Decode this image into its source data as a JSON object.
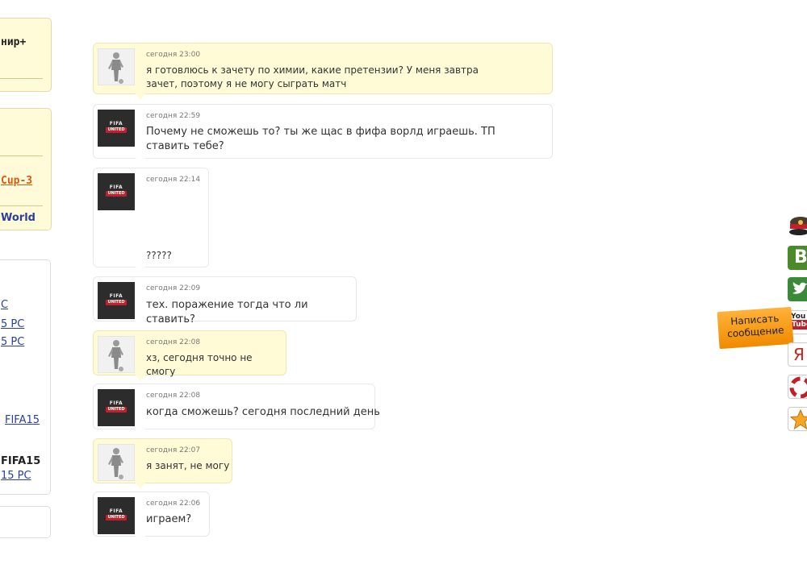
{
  "sidebar": {
    "box1_text": "нир+",
    "box2_link1": "Cup-3",
    "box2_link2": "World",
    "box3_items": [
      "C",
      "5 PC",
      "5 PC",
      "FIFA15"
    ],
    "box3_bold": "FIFA15",
    "box3_last": "15 PC"
  },
  "messages": [
    {
      "time": "сегодня 23:00",
      "text": "я готовлюсь к зачету по химии, какие претензии? У меня завтра зачет, поэтому я не могу сыграть матч",
      "avatar": "player-avatar",
      "mine": true
    },
    {
      "time": "сегодня 22:59",
      "text": "Почему не сможешь то? ты же щас в фифа ворлд играешь. ТП ставить тебе?",
      "avatar": "fifa-united-avatar",
      "mine": false
    },
    {
      "time": "сегодня 22:14",
      "text": "?????",
      "avatar": "fifa-united-avatar",
      "mine": false
    },
    {
      "time": "сегодня 22:09",
      "text": "тех. поражение тогда что ли ставить?",
      "avatar": "fifa-united-avatar",
      "mine": false
    },
    {
      "time": "сегодня 22:08",
      "text": "хз, сегодня точно не смогу",
      "avatar": "player-avatar",
      "mine": true
    },
    {
      "time": "сегодня 22:08",
      "text": "когда сможешь? сегодня последний день",
      "avatar": "fifa-united-avatar",
      "mine": false
    },
    {
      "time": "сегодня 22:07",
      "text": "я занят, не могу",
      "avatar": "player-avatar",
      "mine": true
    },
    {
      "time": "сегодня 22:06",
      "text": "играем?",
      "avatar": "fifa-united-avatar",
      "mine": false
    }
  ],
  "avatar_badge": {
    "line1": "FIFA",
    "line2": "UNITED"
  },
  "write_button": {
    "line1": "Написать",
    "line2": "сообщение"
  },
  "social": {
    "vk": "B",
    "youtube_top": "You",
    "youtube_bottom": "Tube",
    "yandex": "Я"
  }
}
